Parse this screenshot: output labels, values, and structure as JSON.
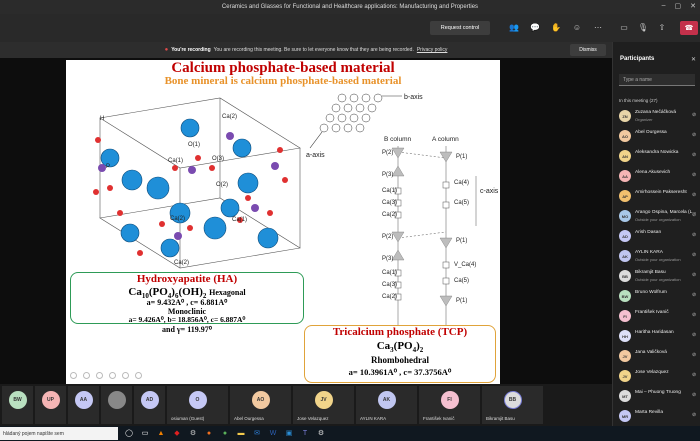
{
  "window": {
    "title": "Ceramics and Glasses for Functional and Healthcare applications: Manufacturing and Properties"
  },
  "toolbar": {
    "request_control": "Request control",
    "icons": [
      "people-icon",
      "chat-icon",
      "raise-hand-icon",
      "reactions-icon",
      "more-icon",
      "camera-icon",
      "mic-icon",
      "share-icon"
    ]
  },
  "banner": {
    "bold": "You're recording",
    "text": "You are recording this meeting. Be sure to let everyone know that they are being recorded.",
    "link": "Privacy policy",
    "dismiss": "Dismiss"
  },
  "slide": {
    "title": "Calcium phosphate-based material",
    "subtitle": "Bone mineral is calcium phosphate-based material",
    "labels": {
      "h": "H",
      "ca2_a": "Ca(2)",
      "o1": "O(1)",
      "o3": "O(3)",
      "ca1_a": "Ca(1)",
      "p": "P",
      "o2": "O(2)",
      "ca2_b": "Ca(2)",
      "ca1_b": "Ca(1)",
      "ca2_c": "Ca(2)",
      "a_axis": "a-axis",
      "b_axis": "b-axis",
      "c_axis": "c-axis",
      "b_column": "B column",
      "a_column": "A column",
      "col_b": [
        "P(2)",
        "P(3)",
        "Ca(1)",
        "Ca(3)",
        "Ca(2)",
        "P(2)",
        "P(3)",
        "Ca(1)",
        "Ca(3)",
        "Ca(2)"
      ],
      "col_a": [
        "P(1)",
        "Ca(4)",
        "Ca(5)",
        "P(1)",
        "V_Ca(4)",
        "Ca(5)",
        "P(1)"
      ]
    },
    "ha": {
      "title": "Hydroxyapatite (HA)",
      "formula_main": "Ca",
      "formula_s1": "10",
      "formula_mid": "(PO",
      "formula_s2": "4",
      "formula_mid2": ")",
      "formula_s3": "6",
      "formula_end": "(OH)",
      "formula_s4": "2",
      "system1": "Hexagonal",
      "params1": "a= 9.432A⁰ , c= 6.881A⁰",
      "system2": "Monoclinic",
      "params2": "a= 9.426A⁰, b= 18.856A⁰, c= 6.887A⁰",
      "params3": "and γ= 119.97⁰"
    },
    "tcp": {
      "title": "Tricalcium phosphate (TCP)",
      "formula_a": "Ca",
      "formula_s1": "3",
      "formula_b": "(PO",
      "formula_s2": "4",
      "formula_c": ")",
      "formula_s3": "2",
      "system": "Rhombohedral",
      "params": "a= 10.3961A⁰ , c= 37.3756A⁰"
    }
  },
  "participants": {
    "title": "Participants",
    "search_placeholder": "Type a name",
    "in_meeting": "In this meeting (27)",
    "list": [
      {
        "initials": "ZN",
        "name": "Zuzana Nečáčková",
        "sub": "Organizer",
        "color": "#e8d5a8"
      },
      {
        "initials": "AO",
        "name": "Abel Ourgessa",
        "sub": "",
        "color": "#f2c9a0"
      },
      {
        "initials": "AN",
        "name": "Aleksandra Nowicka",
        "sub": "",
        "color": "#f1d48a"
      },
      {
        "initials": "AA",
        "name": "Alena Akusevich",
        "sub": "",
        "color": "#f5b5b5"
      },
      {
        "initials": "AP",
        "name": "Amirhossein Pakseresht",
        "sub": "",
        "color": "#f2c06e"
      },
      {
        "initials": "MO",
        "name": "Arango Ospina, Marcela (L...",
        "sub": "Outside your organization",
        "color": "#a8c8e8"
      },
      {
        "initials": "AD",
        "name": "Arish Dasan",
        "sub": "",
        "color": "#c5c8f5"
      },
      {
        "initials": "AK",
        "name": "AYLIN KARA",
        "sub": "Outside your organization",
        "color": "#c0c6f0"
      },
      {
        "initials": "BB",
        "name": "Bikramjit Basu",
        "sub": "Outside your organization",
        "color": "#dcdcdc"
      },
      {
        "initials": "BW",
        "name": "Bruno Wolfrum",
        "sub": "",
        "color": "#b9e0c0"
      },
      {
        "initials": "FI",
        "name": "František Ivanič",
        "sub": "",
        "color": "#f5c0d0"
      },
      {
        "initials": "HH",
        "name": "Haritha Haridasan",
        "sub": "",
        "color": "#dde0f8"
      },
      {
        "initials": "JV",
        "name": "Jana Valičková",
        "sub": "",
        "color": "#f2c9a0"
      },
      {
        "initials": "JV",
        "name": "Jose Velazquez",
        "sub": "",
        "color": "#f1d48a"
      },
      {
        "initials": "MT",
        "name": "Mai – Phuong Truong",
        "sub": "",
        "color": "#dcdcdc"
      },
      {
        "initials": "MR",
        "name": "Marta Revilla",
        "sub": "",
        "color": "#c5c8f5"
      }
    ]
  },
  "tiles": [
    {
      "initials": "BW",
      "name": "",
      "color": "#b9e0c0"
    },
    {
      "initials": "UP",
      "name": "",
      "color": "#f5b5b5"
    },
    {
      "initials": "AA",
      "name": "",
      "color": "#c5c8f5"
    },
    {
      "initials": "",
      "name": "",
      "color": "#888888"
    },
    {
      "initials": "AD",
      "name": "",
      "color": "#c5c8f5"
    },
    {
      "initials": "O",
      "name": "osiuman (Guest)",
      "color": "#c5c8f5"
    },
    {
      "initials": "AO",
      "name": "Abel Ourgessa",
      "color": "#f2c9a0"
    },
    {
      "initials": "JV",
      "name": "Jose Velazquez",
      "color": "#f1d48a"
    },
    {
      "initials": "AK",
      "name": "AYLIN KARA",
      "color": "#c0c6f0"
    },
    {
      "initials": "FI",
      "name": "František Ivanič",
      "color": "#f5c0d0"
    },
    {
      "initials": "BB",
      "name": "Bikramjit Basu",
      "color": "#dcdcdc"
    }
  ],
  "taskbar": {
    "search": "hládaný pojem napište sem"
  }
}
